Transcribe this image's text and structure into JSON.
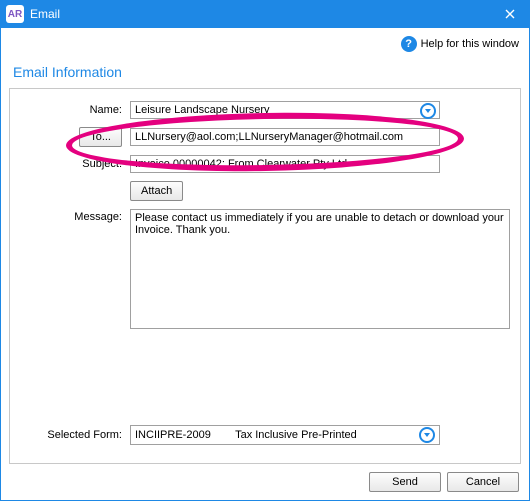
{
  "window": {
    "app_badge": "AR",
    "title": "Email"
  },
  "help": {
    "link_text": "Help for this window"
  },
  "section_title": "Email Information",
  "labels": {
    "name": "Name:",
    "to_button": "To...",
    "subject": "Subject:",
    "attach_button": "Attach",
    "message": "Message:",
    "selected_form": "Selected Form:"
  },
  "fields": {
    "name": "Leisure Landscape Nursery",
    "to": "LLNursery@aol.com;LLNurseryManager@hotmail.com",
    "subject": "Invoice 00000042; From Clearwater Pty Ltd",
    "message": "Please contact us immediately if you are unable to detach or download your Invoice. Thank you.",
    "selected_form_code": "INCIIPRE-2009",
    "selected_form_desc": "Tax Inclusive Pre-Printed"
  },
  "buttons": {
    "send": "Send",
    "cancel": "Cancel"
  }
}
